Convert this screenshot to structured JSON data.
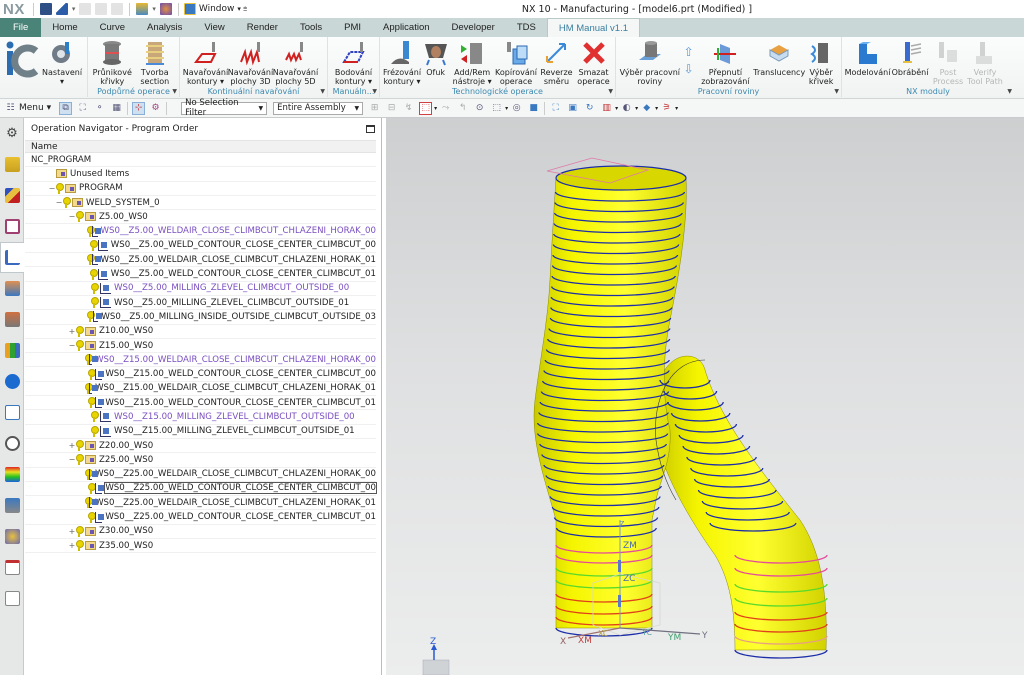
{
  "app": {
    "logo": "NX",
    "window_title": "NX 10 - Manufacturing - [model6.prt (Modified) ]",
    "window_menu": "Window"
  },
  "quick_access": [
    {
      "name": "save-icon"
    },
    {
      "name": "undo-icon"
    },
    {
      "name": "cut-icon"
    },
    {
      "name": "copy-icon"
    },
    {
      "name": "paste-icon"
    },
    {
      "name": "repeat-command-icon"
    },
    {
      "name": "touch-mode-icon"
    }
  ],
  "tabs": [
    "File",
    "Home",
    "Curve",
    "Analysis",
    "View",
    "Render",
    "Tools",
    "PMI",
    "Application",
    "Developer",
    "TDS",
    "HM Manual v1.1"
  ],
  "active_tab": "HM Manual v1.1",
  "ribbon": {
    "groups": [
      {
        "label": "",
        "buttons": [
          {
            "label": "",
            "icon": "ic-logo-icon"
          },
          {
            "label": "Nastavení ▾",
            "icon": "settings-gear-icon"
          }
        ]
      },
      {
        "label": "Podpůrné operace",
        "buttons": [
          {
            "label": "Průnikové křivky",
            "icon": "intersection-curves-icon"
          },
          {
            "label": "Tvorba section",
            "icon": "create-section-icon"
          }
        ]
      },
      {
        "label": "Kontinuální navařování",
        "buttons": [
          {
            "label": "Navařování kontury ▾",
            "icon": "weld-contour-icon"
          },
          {
            "label": "Navařování plochy 3D",
            "icon": "weld-surface-3d-icon"
          },
          {
            "label": "Navařování plochy 5D",
            "icon": "weld-surface-5d-icon"
          }
        ]
      },
      {
        "label": "Manuáln...",
        "buttons": [
          {
            "label": "Bodování kontury ▾",
            "icon": "spot-contour-icon"
          }
        ]
      },
      {
        "label": "Technologické operace",
        "buttons": [
          {
            "label": "Frézování kontury ▾",
            "icon": "mill-contour-icon"
          },
          {
            "label": "Ofuk",
            "icon": "blow-off-icon"
          },
          {
            "label": "Add/Rem nástroje ▾",
            "icon": "add-remove-tools-icon"
          },
          {
            "label": "Kopírování operace",
            "icon": "copy-operation-icon"
          },
          {
            "label": "Reverze směru",
            "icon": "reverse-direction-icon"
          },
          {
            "label": "Smazat operace",
            "icon": "delete-operation-icon"
          }
        ]
      },
      {
        "label": "Pracovní roviny",
        "buttons": [
          {
            "label": "Výběr pracovní roviny",
            "icon": "select-work-plane-icon"
          },
          {
            "label": "",
            "icon": "arrow-up-down-icon"
          },
          {
            "label": "Přepnutí zobrazování",
            "icon": "toggle-display-icon"
          },
          {
            "label": "Translucency",
            "icon": "translucency-icon"
          },
          {
            "label": "Výběr křivek",
            "icon": "select-curves-icon"
          }
        ]
      },
      {
        "label": "NX moduly",
        "buttons": [
          {
            "label": "Modelování",
            "icon": "modeling-icon"
          },
          {
            "label": "Obrábění",
            "icon": "machining-icon"
          },
          {
            "label": "Post Process",
            "icon": "post-process-icon",
            "disabled": true
          },
          {
            "label": "Verify Tool Path",
            "icon": "verify-toolpath-icon",
            "disabled": true
          }
        ]
      }
    ]
  },
  "toolbar2": {
    "menu_label": "Menu ▾",
    "selection_filter": "No Selection Filter",
    "scope": "Entire Assembly"
  },
  "navigator": {
    "title": "Operation Navigator - Program Order",
    "column": "Name",
    "rows": [
      {
        "text": "NC_PROGRAM",
        "level": 0,
        "type": "root"
      },
      {
        "text": "Unused Items",
        "level": 1,
        "type": "group",
        "key": false
      },
      {
        "text": "PROGRAM",
        "level": 1,
        "type": "group",
        "exp": "−"
      },
      {
        "text": "WELD_SYSTEM_0",
        "level": 2,
        "type": "group",
        "exp": "−"
      },
      {
        "text": "Z5.00_WS0",
        "level": 3,
        "type": "group",
        "exp": "−"
      },
      {
        "text": "WS0__Z5.00_WELDAIR_CLOSE_CLIMBCUT_CHLAZENI_HORAK_00",
        "level": 4,
        "type": "op",
        "color": "purple"
      },
      {
        "text": "WS0__Z5.00_WELD_CONTOUR_CLOSE_CENTER_CLIMBCUT_00",
        "level": 4,
        "type": "op"
      },
      {
        "text": "WS0__Z5.00_WELDAIR_CLOSE_CLIMBCUT_CHLAZENI_HORAK_01",
        "level": 4,
        "type": "op"
      },
      {
        "text": "WS0__Z5.00_WELD_CONTOUR_CLOSE_CENTER_CLIMBCUT_01",
        "level": 4,
        "type": "op"
      },
      {
        "text": "WS0__Z5.00_MILLING_ZLEVEL_CLIMBCUT_OUTSIDE_00",
        "level": 4,
        "type": "op",
        "color": "purple"
      },
      {
        "text": "WS0__Z5.00_MILLING_ZLEVEL_CLIMBCUT_OUTSIDE_01",
        "level": 4,
        "type": "op"
      },
      {
        "text": "WS0__Z5.00_MILLING_INSIDE_OUTSIDE_CLIMBCUT_OUTSIDE_03",
        "level": 4,
        "type": "op"
      },
      {
        "text": "Z10.00_WS0",
        "level": 3,
        "type": "group",
        "exp": "+"
      },
      {
        "text": "Z15.00_WS0",
        "level": 3,
        "type": "group",
        "exp": "−"
      },
      {
        "text": "WS0__Z15.00_WELDAIR_CLOSE_CLIMBCUT_CHLAZENI_HORAK_00",
        "level": 4,
        "type": "op",
        "color": "purple"
      },
      {
        "text": "WS0__Z15.00_WELD_CONTOUR_CLOSE_CENTER_CLIMBCUT_00",
        "level": 4,
        "type": "op"
      },
      {
        "text": "WS0__Z15.00_WELDAIR_CLOSE_CLIMBCUT_CHLAZENI_HORAK_01",
        "level": 4,
        "type": "op"
      },
      {
        "text": "WS0__Z15.00_WELD_CONTOUR_CLOSE_CENTER_CLIMBCUT_01",
        "level": 4,
        "type": "op"
      },
      {
        "text": "WS0__Z15.00_MILLING_ZLEVEL_CLIMBCUT_OUTSIDE_00",
        "level": 4,
        "type": "op",
        "color": "purple"
      },
      {
        "text": "WS0__Z15.00_MILLING_ZLEVEL_CLIMBCUT_OUTSIDE_01",
        "level": 4,
        "type": "op"
      },
      {
        "text": "Z20.00_WS0",
        "level": 3,
        "type": "group",
        "exp": "+"
      },
      {
        "text": "Z25.00_WS0",
        "level": 3,
        "type": "group",
        "exp": "−"
      },
      {
        "text": "WS0__Z25.00_WELDAIR_CLOSE_CLIMBCUT_CHLAZENI_HORAK_00",
        "level": 4,
        "type": "op"
      },
      {
        "text": "WS0__Z25.00_WELD_CONTOUR_CLOSE_CENTER_CLIMBCUT_00",
        "level": 4,
        "type": "op",
        "selected": true
      },
      {
        "text": "WS0__Z25.00_WELDAIR_CLOSE_CLIMBCUT_CHLAZENI_HORAK_01",
        "level": 4,
        "type": "op"
      },
      {
        "text": "WS0__Z25.00_WELD_CONTOUR_CLOSE_CENTER_CLIMBCUT_01",
        "level": 4,
        "type": "op"
      },
      {
        "text": "Z30.00_WS0",
        "level": 3,
        "type": "group",
        "exp": "+"
      },
      {
        "text": "Z35.00_WS0",
        "level": 3,
        "type": "group",
        "exp": "+"
      }
    ]
  },
  "resource_bar": [
    {
      "name": "settings-gear-icon"
    },
    {
      "name": "assembly-navigator-icon"
    },
    {
      "name": "constraint-navigator-icon"
    },
    {
      "name": "part-navigator-icon"
    },
    {
      "name": "operation-navigator-icon",
      "active": true
    },
    {
      "name": "machine-tool-navigator-icon"
    },
    {
      "name": "reuse-library-icon"
    },
    {
      "name": "hd3d-tools-icon"
    },
    {
      "name": "roles-icon"
    },
    {
      "name": "web-browser-icon"
    },
    {
      "name": "history-icon"
    },
    {
      "name": "palette-icon"
    },
    {
      "name": "process-studio-icon"
    },
    {
      "name": "simulation-icon"
    },
    {
      "name": "report-icon"
    },
    {
      "name": "checklist-icon"
    }
  ],
  "viewport": {
    "axis_labels": {
      "z": "Z",
      "zm": "ZM",
      "zc": "ZC",
      "x": "X",
      "xm": "XM",
      "xc": "XC",
      "yc": "YC",
      "ym": "YM",
      "y": "Y"
    },
    "triad_label": "Z",
    "colors": {
      "part": "#f2f200",
      "weld_line": "#1c2ea8",
      "pink": "#e64a9a",
      "green": "#59d92a",
      "red": "#e0401a",
      "tan": "#e8a080"
    }
  },
  "colors": {
    "file_tab": "#4a8377",
    "tab_bar": "#c9d7d6",
    "group_label": "#3c8ab0",
    "purple_text": "#7a4ec0"
  }
}
